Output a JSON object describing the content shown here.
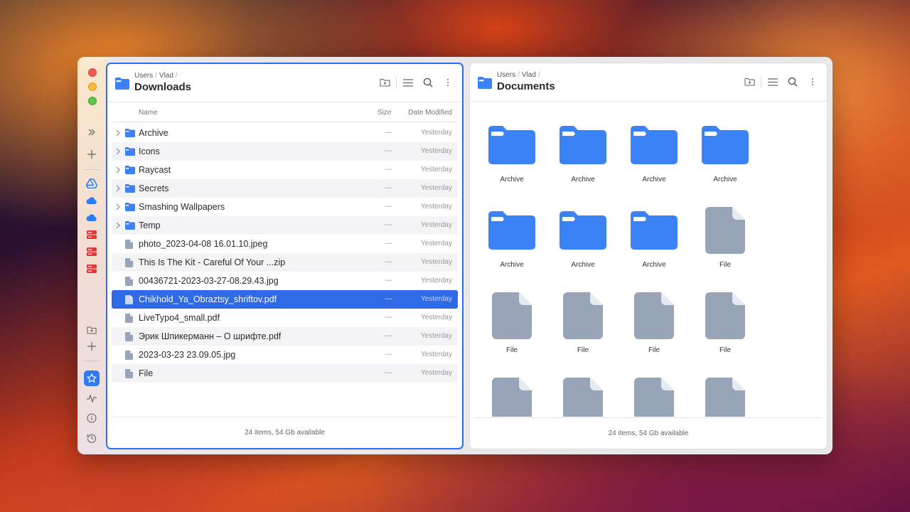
{
  "sidebar": {
    "icons": [
      "expand-icon",
      "add-icon",
      "google-drive-icon",
      "cloud-icon",
      "cloud-icon",
      "server-icon",
      "server-icon",
      "server-icon",
      "new-folder-icon",
      "add-location-icon",
      "favorites-star-icon",
      "activity-icon",
      "info-icon",
      "history-icon"
    ],
    "colors": {
      "drive": "#2f7bf5",
      "server": "#e5343a",
      "star_bg": "#2f7bf5"
    }
  },
  "left_panel": {
    "crumbs": [
      "Users",
      "Vlad"
    ],
    "title": "Downloads",
    "columns": {
      "name": "Name",
      "size": "Size",
      "date": "Date Modified"
    },
    "rows": [
      {
        "name": "Archive",
        "type": "folder",
        "size": "—",
        "date": "Yesterday"
      },
      {
        "name": "Icons",
        "type": "folder",
        "size": "—",
        "date": "Yesterday"
      },
      {
        "name": "Raycast",
        "type": "folder",
        "size": "—",
        "date": "Yesterday"
      },
      {
        "name": "Secrets",
        "type": "folder",
        "size": "—",
        "date": "Yesterday"
      },
      {
        "name": "Smashing Wallpapers",
        "type": "folder",
        "size": "—",
        "date": "Yesterday"
      },
      {
        "name": "Temp",
        "type": "folder",
        "size": "—",
        "date": "Yesterday"
      },
      {
        "name": "photo_2023-04-08 16.01.10.jpeg",
        "type": "file",
        "size": "—",
        "date": "Yesterday"
      },
      {
        "name": "This Is The Kit - Careful Of Your ...zip",
        "type": "file",
        "size": "—",
        "date": "Yesterday"
      },
      {
        "name": "00436721-2023-03-27-08.29.43.jpg",
        "type": "file",
        "size": "—",
        "date": "Yesterday"
      },
      {
        "name": "Chikhold_Ya_Obraztsy_shriftov.pdf",
        "type": "file",
        "size": "—",
        "date": "Yesterday",
        "selected": true
      },
      {
        "name": "LiveTypo4_small.pdf",
        "type": "file",
        "size": "—",
        "date": "Yesterday"
      },
      {
        "name": "Эрик Шпикерманн – О шрифте.pdf",
        "type": "file",
        "size": "—",
        "date": "Yesterday"
      },
      {
        "name": "2023-03-23 23.09.05.jpg",
        "type": "file",
        "size": "—",
        "date": "Yesterday"
      },
      {
        "name": "File",
        "type": "file",
        "size": "—",
        "date": "Yesterday"
      }
    ],
    "footer": "24 items, 54 Gb available"
  },
  "right_panel": {
    "crumbs": [
      "Users",
      "Vlad"
    ],
    "title": "Documents",
    "items": [
      {
        "label": "Archive",
        "type": "folder"
      },
      {
        "label": "Archive",
        "type": "folder"
      },
      {
        "label": "Archive",
        "type": "folder"
      },
      {
        "label": "Archive",
        "type": "folder"
      },
      {
        "label": "Archive",
        "type": "folder"
      },
      {
        "label": "Archive",
        "type": "folder"
      },
      {
        "label": "Archive",
        "type": "folder"
      },
      {
        "label": "File",
        "type": "file"
      },
      {
        "label": "File",
        "type": "file"
      },
      {
        "label": "File",
        "type": "file"
      },
      {
        "label": "File",
        "type": "file"
      },
      {
        "label": "File",
        "type": "file"
      },
      {
        "label": "",
        "type": "file"
      },
      {
        "label": "",
        "type": "file"
      },
      {
        "label": "",
        "type": "file"
      },
      {
        "label": "",
        "type": "file"
      }
    ],
    "footer": "24 items, 54 Gb available"
  },
  "colors": {
    "folder": "#3b82f6",
    "file": "#98a4b8",
    "accent": "#2f6ae6"
  }
}
